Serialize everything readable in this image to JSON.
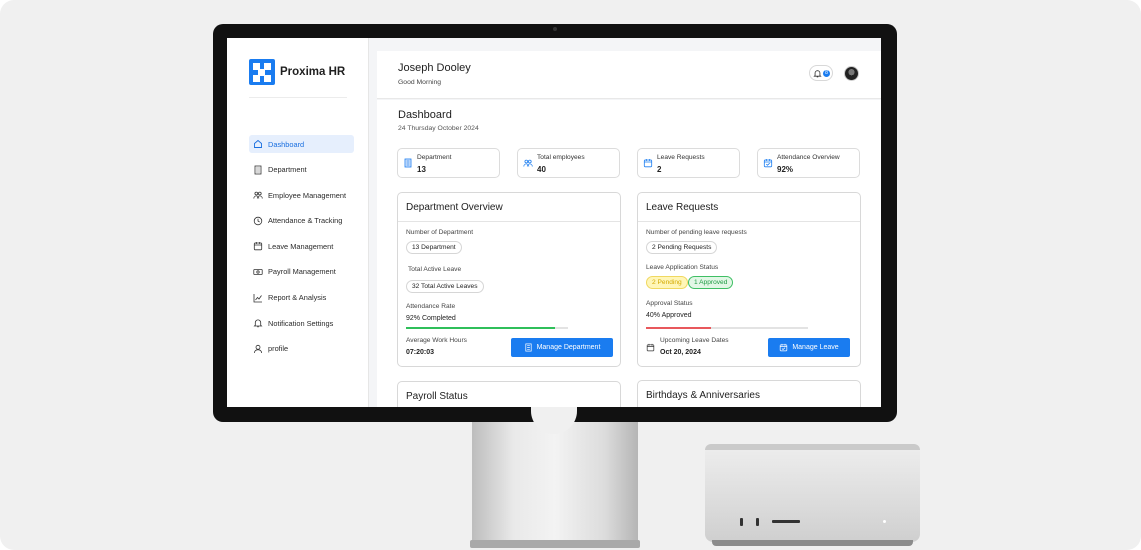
{
  "app": {
    "name": "Proxima HR"
  },
  "sidebar": {
    "items": [
      {
        "label": "Dashboard",
        "icon": "home-icon",
        "active": true
      },
      {
        "label": "Department",
        "icon": "building-icon"
      },
      {
        "label": "Employee Management",
        "icon": "users-icon"
      },
      {
        "label": "Attendance & Tracking",
        "icon": "clock-icon"
      },
      {
        "label": "Leave Management",
        "icon": "calendar-icon"
      },
      {
        "label": "Payroll Management",
        "icon": "banknote-icon"
      },
      {
        "label": "Report & Analysis",
        "icon": "chart-icon"
      },
      {
        "label": "Notification Settings",
        "icon": "bell-icon"
      },
      {
        "label": "profile",
        "icon": "user-icon"
      }
    ]
  },
  "header": {
    "user_name": "Joseph Dooley",
    "greeting": "Good Morning",
    "notification_count": "8"
  },
  "page": {
    "title": "Dashboard",
    "date": "24 Thursday October 2024"
  },
  "stats": [
    {
      "label": "Department",
      "value": "13"
    },
    {
      "label": "Total employees",
      "value": "40"
    },
    {
      "label": "Leave Requests",
      "value": "2"
    },
    {
      "label": "Attendance Overview",
      "value": "92%"
    }
  ],
  "department_overview": {
    "title": "Department  Overview",
    "num_label": "Number of Department",
    "num_value": "13 Department",
    "leave_label": "Total Active Leave",
    "leave_value": "32 Total Active Leaves",
    "attendance_label": "Attendance Rate",
    "attendance_value": "92% Completed",
    "attendance_progress": 0.92,
    "hours_label": "Average Work Hours",
    "hours_value": "07:20:03",
    "button": "Manage Department"
  },
  "leave_requests": {
    "title": "Leave Requests",
    "pending_label": "Number of pending leave requests",
    "pending_value": "2 Pending Requests",
    "status_label": "Leave Application Status",
    "pending_badge": "2 Pending",
    "approved_badge": "1 Approved",
    "approval_label": "Approval Status",
    "approval_value": "40% Approved",
    "approval_progress": 0.4,
    "upcoming_label": "Upcoming Leave Dates",
    "upcoming_value": "Oct 20, 2024",
    "button": "Manage  Leave"
  },
  "payroll": {
    "title": "Payroll Status"
  },
  "birthdays": {
    "title": "Birthdays & Anniversaries"
  },
  "colors": {
    "accent": "#1a7cf0",
    "progress_green": "#2fbf5a",
    "progress_red": "#e8585c"
  }
}
